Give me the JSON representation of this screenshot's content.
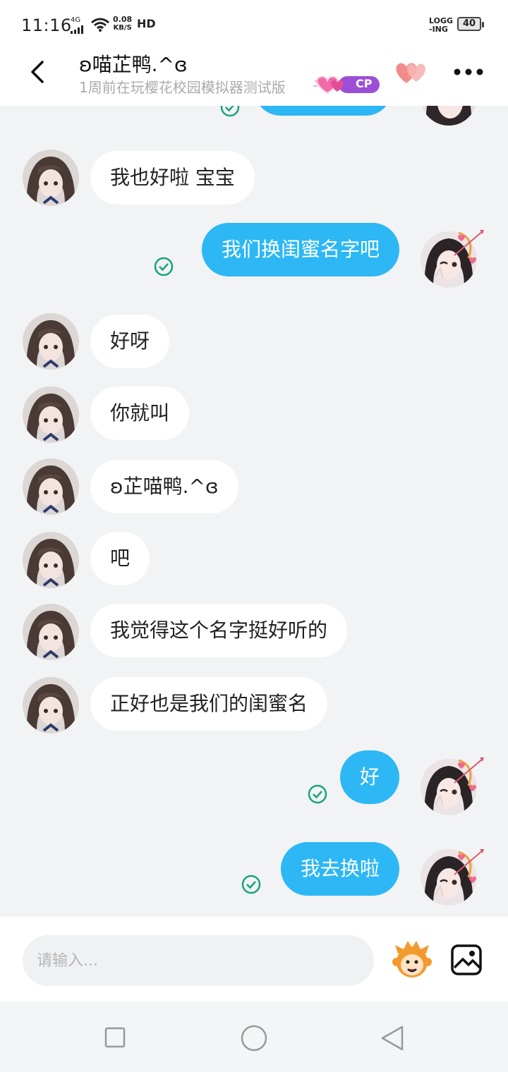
{
  "status_bar": {
    "time": "11:16",
    "network": "4G",
    "speed_value": "0.08",
    "speed_unit": "KB/S",
    "hd": "HD",
    "logging_1": "LOGG",
    "logging_2": "-ING",
    "battery": "40"
  },
  "header": {
    "title": "ʚ喵芷鸭.^ɞ",
    "subtitle": "1周前在玩樱花校园模拟器测试版",
    "badge": "CP"
  },
  "messages": [
    {
      "side": "in",
      "text": "我也好啦 宝宝"
    },
    {
      "side": "out",
      "text": "我们换闺蜜名字吧"
    },
    {
      "side": "in",
      "text": "好呀"
    },
    {
      "side": "in",
      "text": "你就叫"
    },
    {
      "side": "in",
      "text": "ʚ芷喵鸭.^ɞ"
    },
    {
      "side": "in",
      "text": "吧"
    },
    {
      "side": "in",
      "text": "我觉得这个名字挺好听的"
    },
    {
      "side": "in",
      "text": "正好也是我们的闺蜜名"
    },
    {
      "side": "out",
      "text": "好"
    },
    {
      "side": "out",
      "text": "我去换啦"
    }
  ],
  "input": {
    "placeholder": "请输入..."
  },
  "colors": {
    "accent": "#2db7f5",
    "check": "#1aa37a",
    "badge": "#9b4fd6"
  }
}
